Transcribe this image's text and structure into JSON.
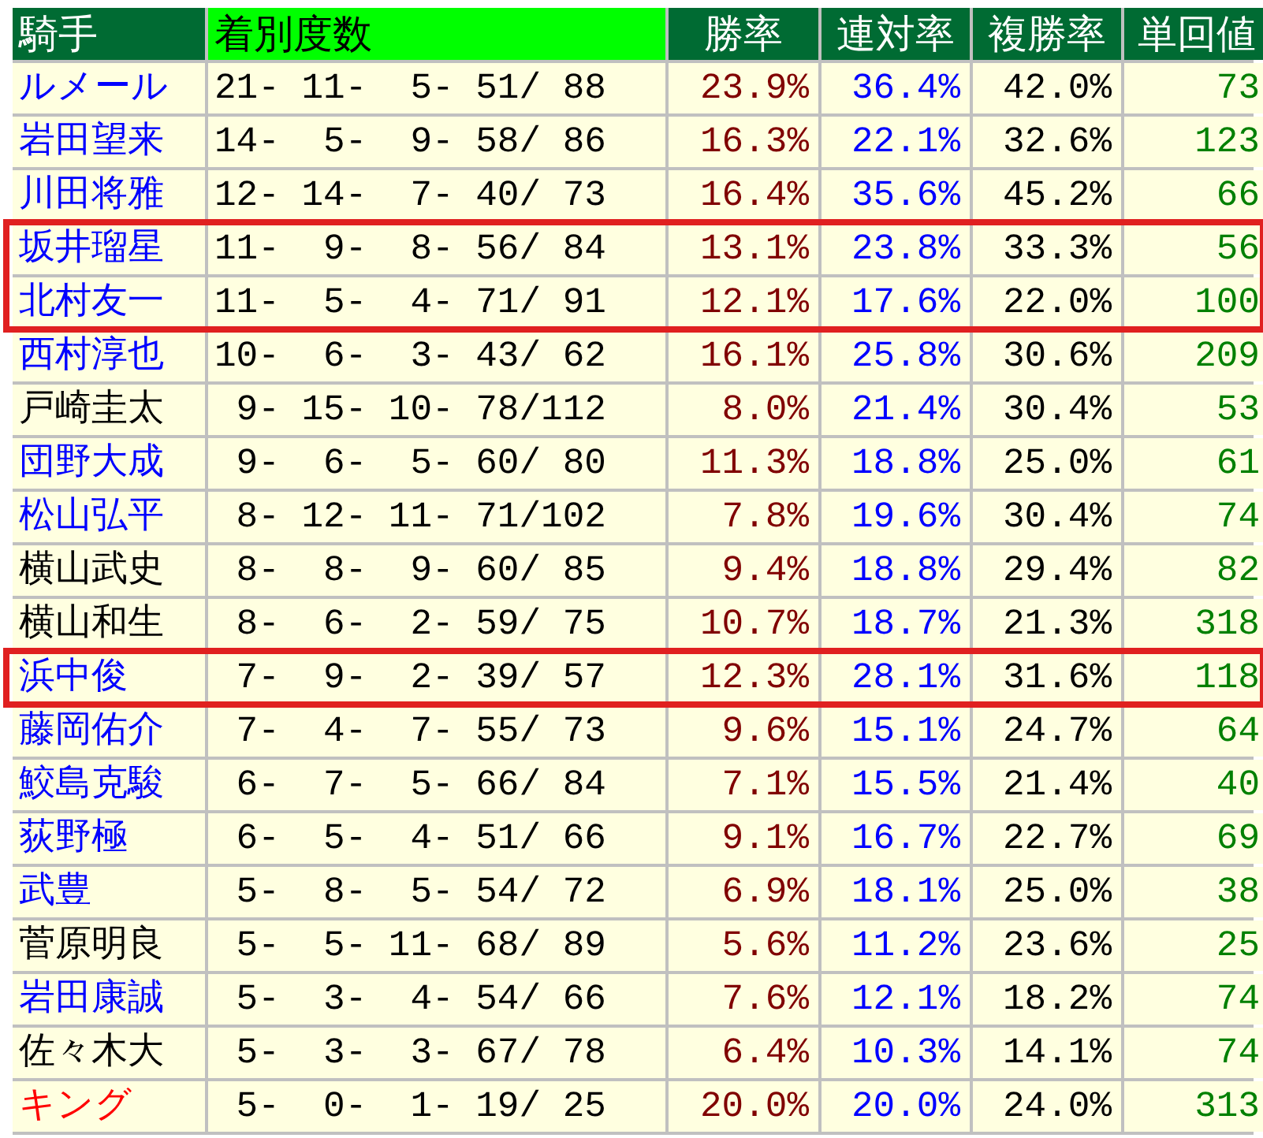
{
  "table": {
    "columns": [
      {
        "label": "騎手",
        "selected": false
      },
      {
        "label": "着別度数",
        "selected": true
      },
      {
        "label": "勝率",
        "selected": false
      },
      {
        "label": "連対率",
        "selected": false
      },
      {
        "label": "複勝率",
        "selected": false
      },
      {
        "label": "単回値",
        "selected": false
      }
    ],
    "rows": [
      {
        "name": "ルメール",
        "color": "#0000ff",
        "record": "21- 11-  5- 51/ 88",
        "win": "23.9%",
        "quinella": "36.4%",
        "place": "42.0%",
        "return": "73",
        "highlighted": false
      },
      {
        "name": "岩田望来",
        "color": "#0000ff",
        "record": "14-  5-  9- 58/ 86",
        "win": "16.3%",
        "quinella": "22.1%",
        "place": "32.6%",
        "return": "123",
        "highlighted": false
      },
      {
        "name": "川田将雅",
        "color": "#0000ff",
        "record": "12- 14-  7- 40/ 73",
        "win": "16.4%",
        "quinella": "35.6%",
        "place": "45.2%",
        "return": "66",
        "highlighted": false
      },
      {
        "name": "坂井瑠星",
        "color": "#0000ff",
        "record": "11-  9-  8- 56/ 84",
        "win": "13.1%",
        "quinella": "23.8%",
        "place": "33.3%",
        "return": "56",
        "highlighted": true
      },
      {
        "name": "北村友一",
        "color": "#0000ff",
        "record": "11-  5-  4- 71/ 91",
        "win": "12.1%",
        "quinella": "17.6%",
        "place": "22.0%",
        "return": "100",
        "highlighted": true
      },
      {
        "name": "西村淳也",
        "color": "#0000ff",
        "record": "10-  6-  3- 43/ 62",
        "win": "16.1%",
        "quinella": "25.8%",
        "place": "30.6%",
        "return": "209",
        "highlighted": false
      },
      {
        "name": "戸崎圭太",
        "color": "#000000",
        "record": " 9- 15- 10- 78/112",
        "win": "8.0%",
        "quinella": "21.4%",
        "place": "30.4%",
        "return": "53",
        "highlighted": false
      },
      {
        "name": "団野大成",
        "color": "#0000ff",
        "record": " 9-  6-  5- 60/ 80",
        "win": "11.3%",
        "quinella": "18.8%",
        "place": "25.0%",
        "return": "61",
        "highlighted": false
      },
      {
        "name": "松山弘平",
        "color": "#0000ff",
        "record": " 8- 12- 11- 71/102",
        "win": "7.8%",
        "quinella": "19.6%",
        "place": "30.4%",
        "return": "74",
        "highlighted": false
      },
      {
        "name": "横山武史",
        "color": "#000000",
        "record": " 8-  8-  9- 60/ 85",
        "win": "9.4%",
        "quinella": "18.8%",
        "place": "29.4%",
        "return": "82",
        "highlighted": false
      },
      {
        "name": "横山和生",
        "color": "#000000",
        "record": " 8-  6-  2- 59/ 75",
        "win": "10.7%",
        "quinella": "18.7%",
        "place": "21.3%",
        "return": "318",
        "highlighted": false
      },
      {
        "name": "浜中俊",
        "color": "#0000ff",
        "record": " 7-  9-  2- 39/ 57",
        "win": "12.3%",
        "quinella": "28.1%",
        "place": "31.6%",
        "return": "118",
        "highlighted": true
      },
      {
        "name": "藤岡佑介",
        "color": "#0000ff",
        "record": " 7-  4-  7- 55/ 73",
        "win": "9.6%",
        "quinella": "15.1%",
        "place": "24.7%",
        "return": "64",
        "highlighted": false
      },
      {
        "name": "鮫島克駿",
        "color": "#0000ff",
        "record": " 6-  7-  5- 66/ 84",
        "win": "7.1%",
        "quinella": "15.5%",
        "place": "21.4%",
        "return": "40",
        "highlighted": false
      },
      {
        "name": "荻野極",
        "color": "#0000ff",
        "record": " 6-  5-  4- 51/ 66",
        "win": "9.1%",
        "quinella": "16.7%",
        "place": "22.7%",
        "return": "69",
        "highlighted": false
      },
      {
        "name": "武豊",
        "color": "#0000ff",
        "record": " 5-  8-  5- 54/ 72",
        "win": "6.9%",
        "quinella": "18.1%",
        "place": "25.0%",
        "return": "38",
        "highlighted": false
      },
      {
        "name": "菅原明良",
        "color": "#000000",
        "record": " 5-  5- 11- 68/ 89",
        "win": "5.6%",
        "quinella": "11.2%",
        "place": "23.6%",
        "return": "25",
        "highlighted": false
      },
      {
        "name": "岩田康誠",
        "color": "#0000ff",
        "record": " 5-  3-  4- 54/ 66",
        "win": "7.6%",
        "quinella": "12.1%",
        "place": "18.2%",
        "return": "74",
        "highlighted": false
      },
      {
        "name": "佐々木大",
        "color": "#000000",
        "record": " 5-  3-  3- 67/ 78",
        "win": "6.4%",
        "quinella": "10.3%",
        "place": "14.1%",
        "return": "74",
        "highlighted": false
      },
      {
        "name": "キング",
        "color": "#ff0000",
        "record": " 5-  0-  1- 19/ 25",
        "win": "20.0%",
        "quinella": "20.0%",
        "place": "24.0%",
        "return": "313",
        "highlighted": false
      }
    ]
  }
}
